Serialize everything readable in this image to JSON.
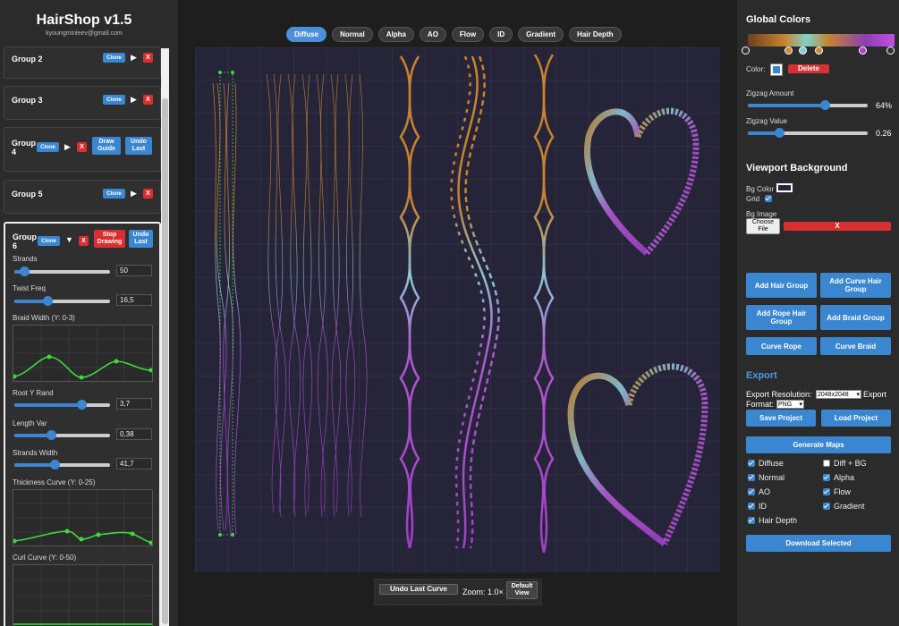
{
  "app": {
    "title": "HairShop v1.5",
    "email": "kyoungminleev@gmail.com"
  },
  "groups": [
    {
      "name": "Group 2",
      "clone": "Clone",
      "x": "X"
    },
    {
      "name": "Group 3",
      "clone": "Clone",
      "x": "X"
    },
    {
      "name": "Group 4",
      "clone": "Clone",
      "x": "X",
      "draw_guide": "Draw Guide",
      "undo_last": "Undo Last"
    },
    {
      "name": "Group 5",
      "clone": "Clone",
      "x": "X"
    },
    {
      "name": "Group 6",
      "clone": "Clone",
      "x": "X",
      "stop_drawing": "Stop Drawing",
      "undo_last": "Undo Last"
    }
  ],
  "group6_params": {
    "strands": {
      "label": "Strands",
      "value": "50",
      "fraction": 0.1
    },
    "twist_freq": {
      "label": "Twist Freq",
      "value": "16,5",
      "fraction": 0.35
    },
    "braid_width": {
      "label": "Braid Width (Y: 0-3)"
    },
    "root_y_rand": {
      "label": "Root Y Rand",
      "value": "3,7",
      "fraction": 0.7
    },
    "length_var": {
      "label": "Length Var",
      "value": "0,38",
      "fraction": 0.38
    },
    "strands_width": {
      "label": "Strands Width",
      "value": "41,7",
      "fraction": 0.42
    },
    "thickness_curve": {
      "label": "Thickness Curve (Y: 0-25)"
    },
    "curl_curve": {
      "label": "Curl Curve (Y: 0-50)"
    }
  },
  "tabs": [
    "Diffuse",
    "Normal",
    "Alpha",
    "AO",
    "Flow",
    "ID",
    "Gradient",
    "Hair Depth"
  ],
  "active_tab": "Diffuse",
  "bottom_bar": {
    "undo_label": "Undo Last Curve",
    "zoom_label": "Zoom: 1.0×",
    "default_view": "Default View"
  },
  "global_colors": {
    "title": "Global Colors",
    "color_label": "Color:",
    "delete_label": "Delete",
    "zigzag_amount_label": "Zigzag Amount",
    "zigzag_amount_value": "64%",
    "zigzag_amount_fraction": 0.64,
    "zigzag_value_label": "Zigzag Value",
    "zigzag_value_value": "0.26",
    "zigzag_value_fraction": 0.26,
    "stops": [
      "#ffffff",
      "#d08a3c",
      "#7fd0c8",
      "#d08a3c",
      "#b040d0",
      "#ffffff"
    ]
  },
  "viewport": {
    "title": "Viewport Background",
    "bg_color_label": "Bg Color",
    "grid_label": "Grid",
    "bg_image_label": "Bg Image",
    "choose_file": "Choose File",
    "x_label": "X"
  },
  "actions": {
    "add_hair_group": "Add Hair Group",
    "add_curve_hair_group": "Add Curve Hair Group",
    "add_rope_hair_group": "Add Rope Hair Group",
    "add_braid_group": "Add Braid Group",
    "curve_rope": "Curve Rope",
    "curve_braid": "Curve Braid"
  },
  "export": {
    "title": "Export",
    "resolution_label": "Export Resolution:",
    "resolution_value": "2048x2048",
    "format_label_a": "Export",
    "format_label_b": "Format:",
    "format_value": "PNG",
    "save_project": "Save Project",
    "load_project": "Load Project",
    "generate_maps": "Generate Maps",
    "download_selected": "Download Selected",
    "maps": [
      {
        "label": "Diffuse",
        "checked": true
      },
      {
        "label": "Diff + BG",
        "checked": false
      },
      {
        "label": "Normal",
        "checked": true
      },
      {
        "label": "Alpha",
        "checked": true
      },
      {
        "label": "AO",
        "checked": true
      },
      {
        "label": "Flow",
        "checked": true
      },
      {
        "label": "ID",
        "checked": true
      },
      {
        "label": "Gradient",
        "checked": true
      },
      {
        "label": "Hair Depth",
        "checked": true
      }
    ]
  },
  "colors": {
    "accent": "#3a86d1",
    "danger": "#d83030",
    "canvas": "#262438",
    "panel": "#2b2b2b"
  }
}
